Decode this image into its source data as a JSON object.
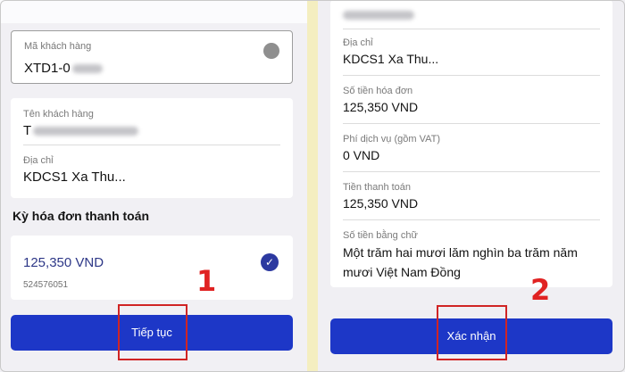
{
  "left_panel": {
    "customer_code": {
      "label": "Mã khách hàng",
      "value": "XTD1-0"
    },
    "customer_name": {
      "label": "Tên khách hàng",
      "value": "T"
    },
    "address": {
      "label": "Địa chỉ",
      "value": "KDCS1 Xa Thu..."
    },
    "section_title": "Kỳ hóa đơn thanh toán",
    "bill": {
      "amount": "125,350 VND",
      "bill_id": "524576051",
      "selected": true
    },
    "continue_button": "Tiếp tục",
    "step_label": "1"
  },
  "right_panel": {
    "address": {
      "label": "Địa chỉ",
      "value": "KDCS1 Xa Thu..."
    },
    "invoice_amount": {
      "label": "Số tiền hóa đơn",
      "value": "125,350 VND"
    },
    "service_fee": {
      "label": "Phí dịch vụ (gồm VAT)",
      "value": "0 VND"
    },
    "payment_amount": {
      "label": "Tiền thanh toán",
      "value": "125,350 VND"
    },
    "amount_in_words": {
      "label": "Số tiền bằng chữ",
      "value": "Một trăm hai mươi lăm nghìn ba trăm năm mươi Việt Nam Đồng"
    },
    "confirm_button": "Xác nhận",
    "step_label": "2"
  },
  "colors": {
    "primary_button": "#1d37c7",
    "highlight": "#d02424",
    "background": "#f4eec0"
  }
}
